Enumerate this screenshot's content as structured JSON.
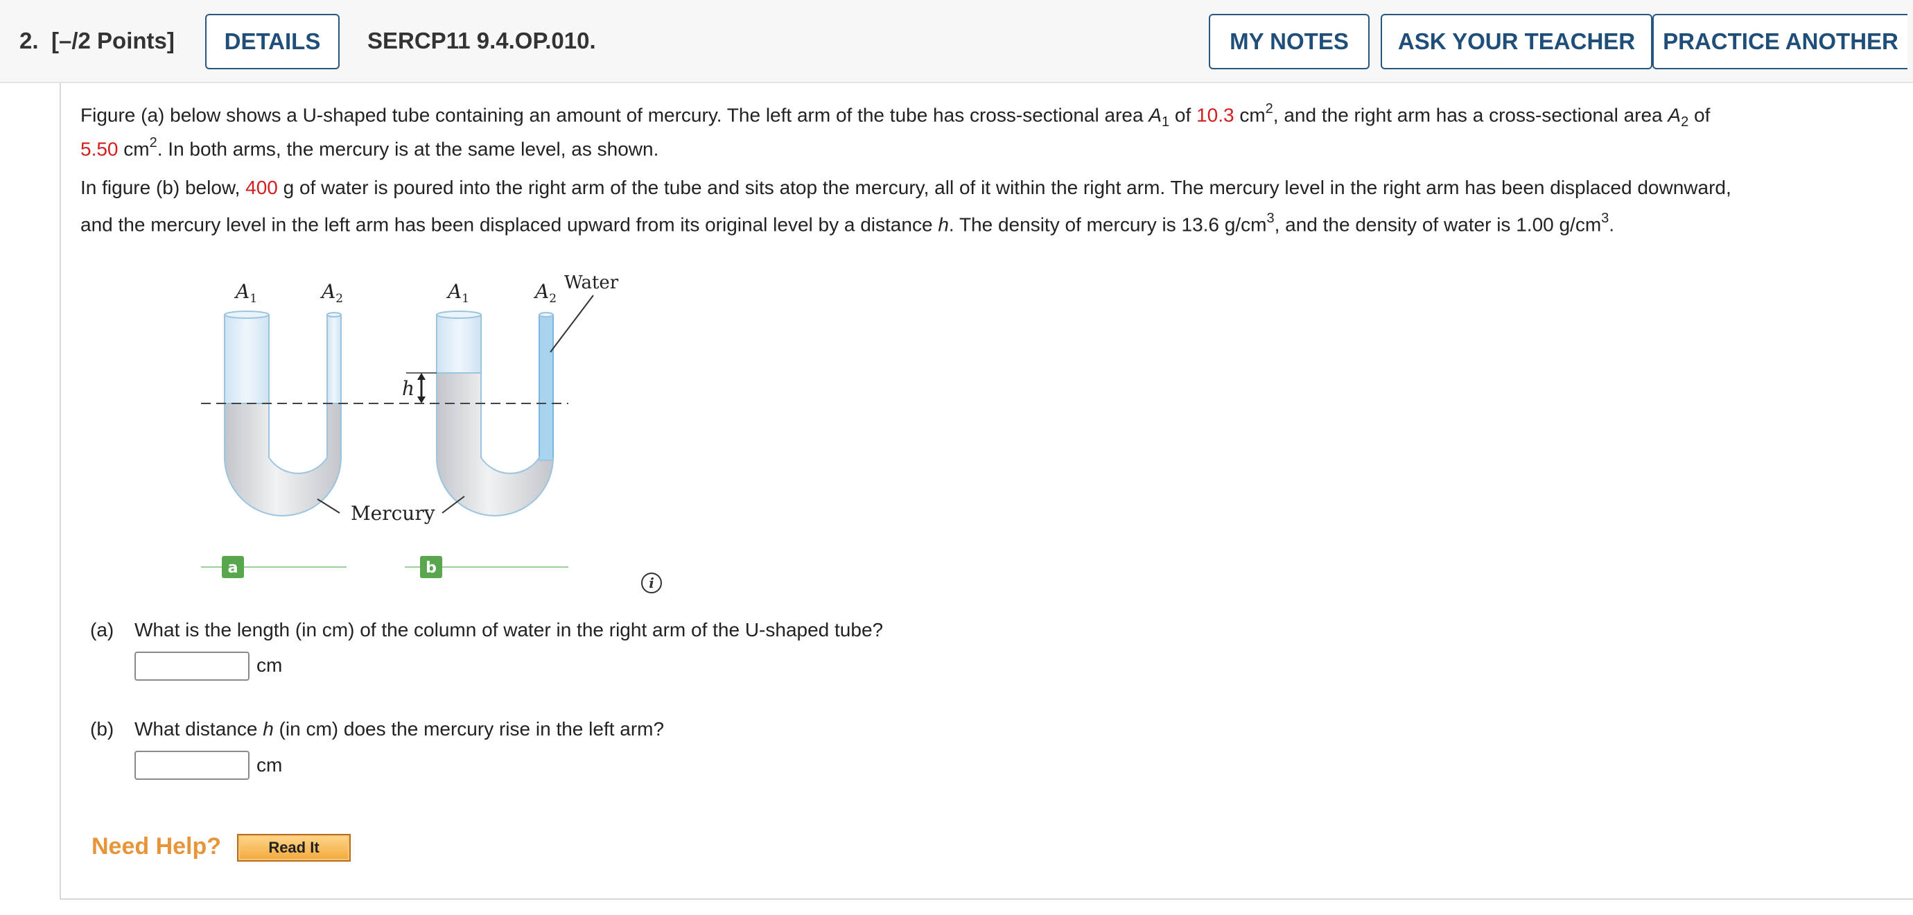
{
  "header": {
    "number": "2.",
    "points": "[–/2 Points]",
    "details": "DETAILS",
    "code": "SERCP11 9.4.OP.010.",
    "my_notes": "MY NOTES",
    "ask_teacher": "ASK YOUR TEACHER",
    "practice": "PRACTICE ANOTHER"
  },
  "problem": {
    "p1_a": "Figure (a) below shows a U-shaped tube containing an amount of mercury. The left arm of the tube has cross-sectional area ",
    "var_A": "A",
    "sub1": "1",
    "of": " of ",
    "area1": "10.3",
    "cm": " cm",
    "sq": "2",
    "p1_b": ", and the right arm has a cross-sectional area ",
    "sub2": "2",
    "of_end": " of",
    "area2": "5.50",
    "p1_c": ". In both arms, the mercury is at the same level, as shown.",
    "p2_a": "In figure (b) below, ",
    "water_mass": "400",
    "p2_b": " g of water is poured into the right arm of the tube and sits atop the mercury, all of it within the right arm. The mercury level in the right arm has been displaced downward,",
    "p3_a": "and the mercury level in the left arm has been displaced upward from its original level by a distance ",
    "var_h": "h",
    "p3_b": ". The density of mercury is 13.6 g/cm",
    "cube": "3",
    "p3_c": ", and the density of water is 1.00 g/cm",
    "p3_d": "."
  },
  "figure": {
    "A": "A",
    "s1": "1",
    "s2": "2",
    "water": "Water",
    "mercury": "Mercury",
    "h": "h",
    "a": "a",
    "b": "b"
  },
  "info_icon": "i",
  "questions": {
    "a_label": "(a)",
    "a_text": "What is the length (in cm) of the column of water in the right arm of the U-shaped tube?",
    "a_unit": "cm",
    "b_label": "(b)",
    "b_text_1": "What distance ",
    "b_var": "h",
    "b_text_2": " (in cm) does the mercury rise in the left arm?",
    "b_unit": "cm"
  },
  "help": {
    "need_help": "Need Help?",
    "read_it": "Read It"
  },
  "colors": {
    "value_red": "#d21f1f",
    "button_blue": "#1f4e79",
    "help_orange": "#e8953a",
    "tube_blue": "#dcebf7",
    "mercury_gray": "#d5d7da",
    "water_blue": "#a8d4f0",
    "label_green": "#5aa64f"
  }
}
